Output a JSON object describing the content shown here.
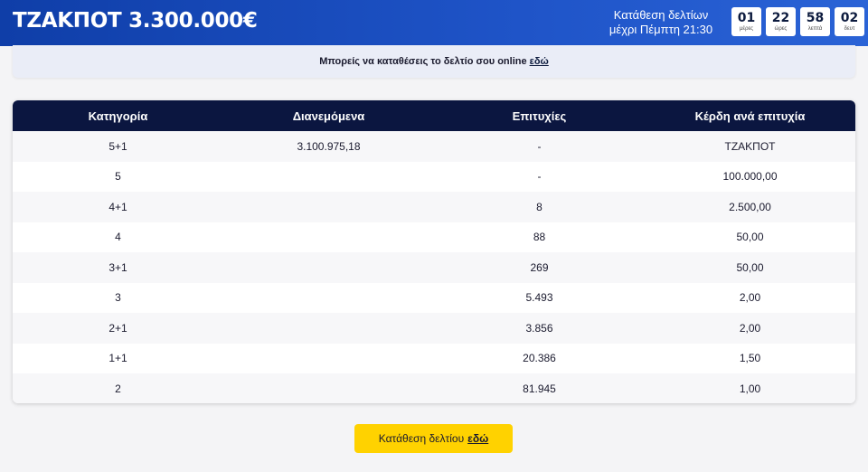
{
  "header": {
    "jackpot": "ΤΖΑΚΠΟΤ 3.300.000€",
    "deadline_line1": "Κατάθεση δελτίων",
    "deadline_line2": "μέχρι Πέμπτη 21:30",
    "countdown": [
      {
        "value": "01",
        "unit": "μέρες"
      },
      {
        "value": "22",
        "unit": "ώρες"
      },
      {
        "value": "58",
        "unit": "λεπτά"
      },
      {
        "value": "02",
        "unit": "δευτ"
      }
    ]
  },
  "info": {
    "text": "Μπορείς να καταθέσεις το δελτίο σου online",
    "link": "εδώ"
  },
  "table": {
    "headers": [
      "Κατηγορία",
      "Διανεμόμενα",
      "Επιτυχίες",
      "Κέρδη ανά επιτυχία"
    ],
    "rows": [
      [
        "5+1",
        "3.100.975,18",
        "-",
        "ΤΖΑΚΠΟΤ"
      ],
      [
        "5",
        "",
        "-",
        "100.000,00"
      ],
      [
        "4+1",
        "",
        "8",
        "2.500,00"
      ],
      [
        "4",
        "",
        "88",
        "50,00"
      ],
      [
        "3+1",
        "",
        "269",
        "50,00"
      ],
      [
        "3",
        "",
        "5.493",
        "2,00"
      ],
      [
        "2+1",
        "",
        "3.856",
        "2,00"
      ],
      [
        "1+1",
        "",
        "20.386",
        "1,50"
      ],
      [
        "2",
        "",
        "81.945",
        "1,00"
      ]
    ]
  },
  "submit": {
    "text": "Κατάθεση δελτίου",
    "link": "εδώ"
  }
}
